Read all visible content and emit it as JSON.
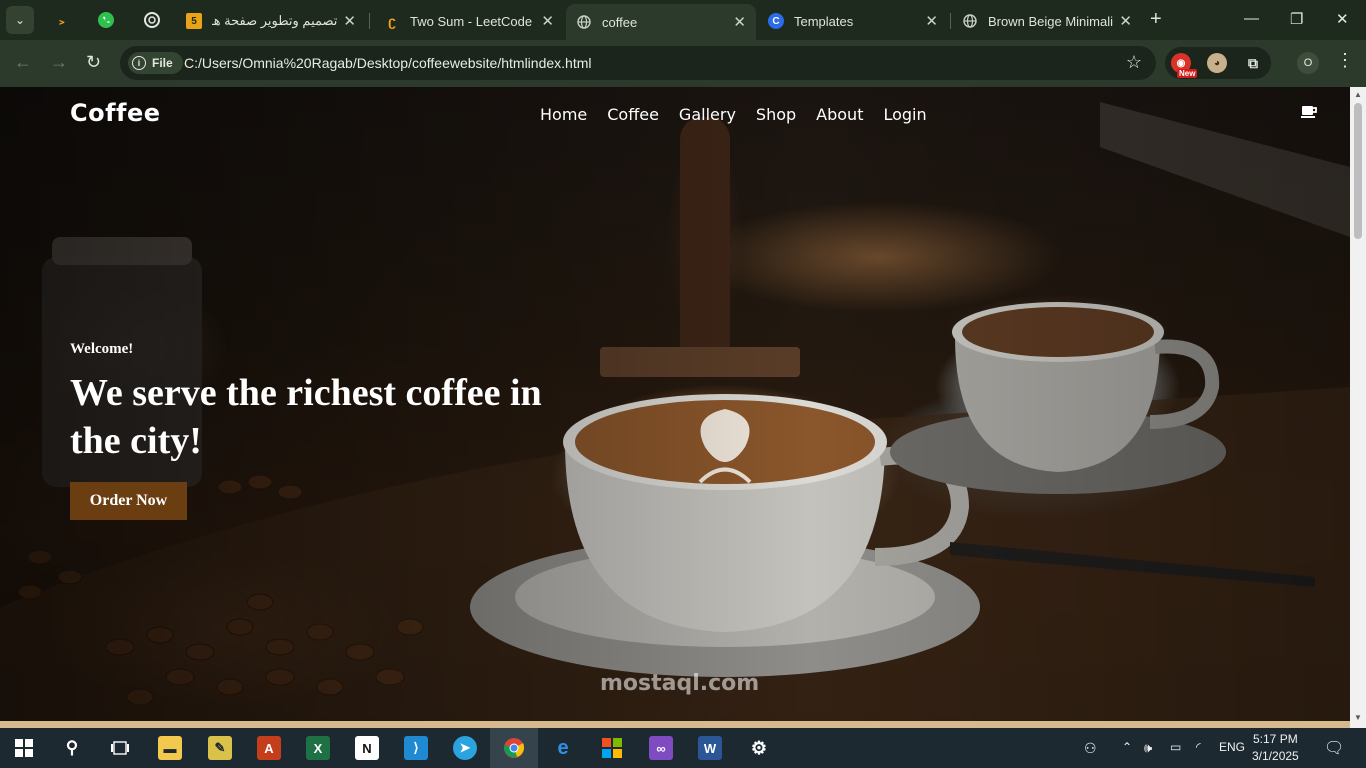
{
  "browser": {
    "tabs": [
      {
        "title": "تصميم وتطوير صفحة هـ",
        "favicon": "5",
        "favicon_color": "#e8a317"
      },
      {
        "title": "Two Sum - LeetCode",
        "favicon": "leetcode",
        "favicon_color": "#f89f1b"
      },
      {
        "title": "coffee",
        "favicon": "globe",
        "favicon_color": "#c8cfc4",
        "active": true
      },
      {
        "title": "Templates",
        "favicon": "C",
        "favicon_color": "#2b6de8"
      },
      {
        "title": "Brown Beige Minimalis",
        "favicon": "globe",
        "favicon_color": "#c8cfc4"
      }
    ],
    "address": {
      "chip_label": "File",
      "url": "C:/Users/Omnia%20Ragab/Desktop/coffeewebsite/htmlindex.html"
    },
    "extension_badge": "New",
    "profile_initial": "O"
  },
  "site": {
    "logo": "Coffee",
    "nav": [
      "Home",
      "Coffee",
      "Gallery",
      "Shop",
      "About",
      "Login"
    ],
    "welcome": "Welcome!",
    "headline": "We serve the richest coffee in the city!",
    "cta": "Order Now",
    "watermark": "mostaql.com",
    "colors": {
      "cta": "#6b3e12",
      "text": "#ffffff"
    }
  },
  "taskbar": {
    "language": "ENG",
    "time": "5:17 PM",
    "date": "3/1/2025"
  }
}
